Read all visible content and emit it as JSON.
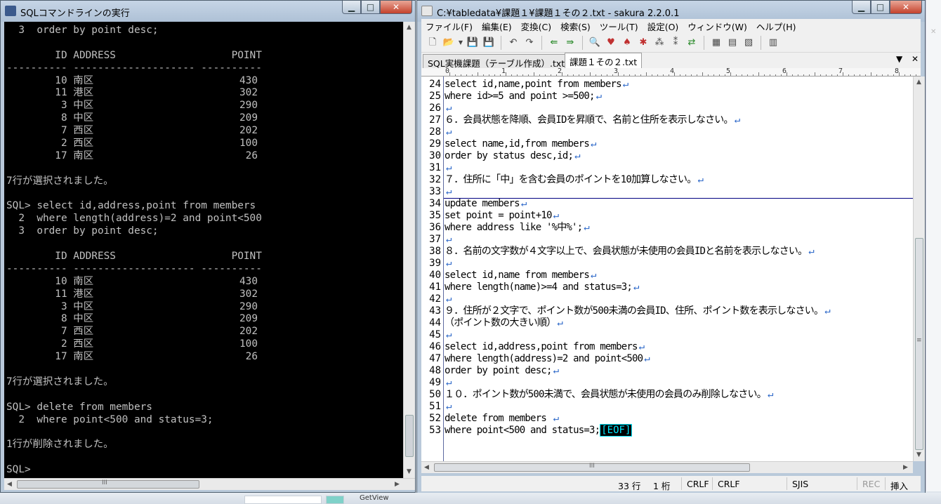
{
  "console": {
    "title": "SQLコマンドラインの実行",
    "lines": [
      "  3  order by point desc;",
      "",
      "        ID ADDRESS                   POINT",
      "---------- -------------------- ----------",
      "        10 南区                        430",
      "        11 港区                        302",
      "         3 中区                        290",
      "         8 中区                        209",
      "         7 西区                        202",
      "         2 西区                        100",
      "        17 南区                         26",
      "",
      "7行が選択されました。",
      "",
      "SQL> select id,address,point from members",
      "  2  where length(address)=2 and point<500",
      "  3  order by point desc;",
      "",
      "        ID ADDRESS                   POINT",
      "---------- -------------------- ----------",
      "        10 南区                        430",
      "        11 港区                        302",
      "         3 中区                        290",
      "         8 中区                        209",
      "         7 西区                        202",
      "         2 西区                        100",
      "        17 南区                         26",
      "",
      "7行が選択されました。",
      "",
      "SQL> delete from members",
      "  2  where point<500 and status=3;",
      "",
      "1行が削除されました。",
      "",
      "SQL>"
    ],
    "hscroll_thumb_mark": "III"
  },
  "editor": {
    "title": "C:¥tabledata¥課題１¥課題１その２.txt - sakura 2.2.0.1",
    "menu": [
      "ファイル(F)",
      "編集(E)",
      "変換(C)",
      "検索(S)",
      "ツール(T)",
      "設定(O)",
      "ウィンドウ(W)",
      "ヘルプ(H)"
    ],
    "tabs": [
      {
        "label": "SQL実機課題（テーブル作成）.txt",
        "active": false
      },
      {
        "label": "課題１その２.txt",
        "active": true
      }
    ],
    "ruler_numbers": [
      "0",
      "1",
      "2",
      "3",
      "4",
      "5",
      "6",
      "7",
      "8"
    ],
    "crlf_mark": "↵",
    "eof_label": "[EOF]",
    "lines": [
      {
        "no": "24",
        "text": "select id,name,point from members"
      },
      {
        "no": "25",
        "text": "where id>=5 and point >=500;"
      },
      {
        "no": "26",
        "text": ""
      },
      {
        "no": "27",
        "text": "６．会員状態を降順、会員IDを昇順で、名前と住所を表示しなさい。"
      },
      {
        "no": "28",
        "text": ""
      },
      {
        "no": "29",
        "text": "select name,id,from members"
      },
      {
        "no": "30",
        "text": "order by status desc,id;"
      },
      {
        "no": "31",
        "text": ""
      },
      {
        "no": "32",
        "text": "７．住所に「中」を含む会員のポイントを10加算しなさい。"
      },
      {
        "no": "33",
        "text": ""
      },
      {
        "no": "34",
        "text": "update members"
      },
      {
        "no": "35",
        "text": "set point = point+10"
      },
      {
        "no": "36",
        "text": "where address like '%中%';"
      },
      {
        "no": "37",
        "text": ""
      },
      {
        "no": "38",
        "text": "８．名前の文字数が４文字以上で、会員状態が未使用の会員IDと名前を表示しなさい。"
      },
      {
        "no": "39",
        "text": ""
      },
      {
        "no": "40",
        "text": "select id,name from members"
      },
      {
        "no": "41",
        "text": "where length(name)>=4 and status=3;"
      },
      {
        "no": "42",
        "text": ""
      },
      {
        "no": "43",
        "text": "９．住所が２文字で、ポイント数が500未満の会員ID、住所、ポイント数を表示しなさい。"
      },
      {
        "no": "44",
        "text": "（ポイント数の大きい順）"
      },
      {
        "no": "45",
        "text": ""
      },
      {
        "no": "46",
        "text": "select id,address,point from members"
      },
      {
        "no": "47",
        "text": "where length(address)=2 and point<500"
      },
      {
        "no": "48",
        "text": "order by point desc;"
      },
      {
        "no": "49",
        "text": ""
      },
      {
        "no": "50",
        "text": "１０．ポイント数が500未満で、会員状態が未使用の会員のみ削除しなさい。"
      },
      {
        "no": "51",
        "text": ""
      },
      {
        "no": "52",
        "text": "delete from members "
      },
      {
        "no": "53",
        "text": "where point<500 and status=3;",
        "eof": true
      }
    ],
    "status": {
      "row": "33 行",
      "col": "1 桁",
      "linebreak1": "CRLF",
      "linebreak2": "CRLF",
      "encoding": "SJIS",
      "rec": "REC",
      "mode": "挿入"
    }
  },
  "taskbar": {
    "item_label": "GetView"
  }
}
